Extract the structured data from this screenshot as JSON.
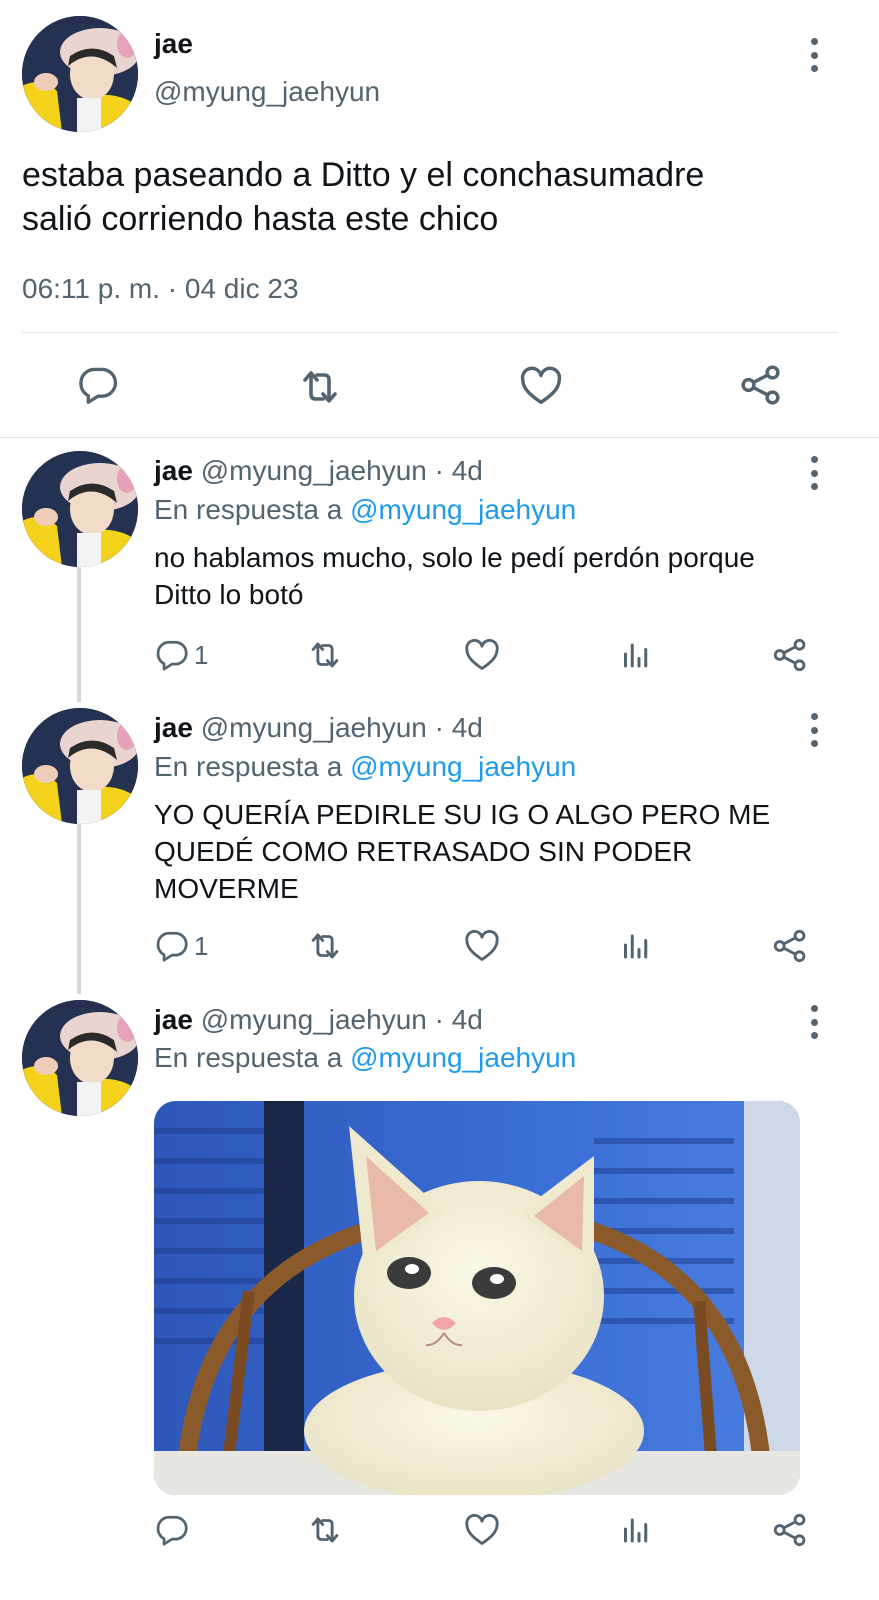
{
  "main_tweet": {
    "display_name": "jae",
    "handle": "@myung_jaehyun",
    "text_line1": "estaba paseando a Ditto y el conchasumadre",
    "text_line2": "salió corriendo hasta este chico",
    "timestamp": "06:11 p. m. · 04 dic 23"
  },
  "replies": [
    {
      "display_name": "jae",
      "handle_time": "@myung_jaehyun · 4d",
      "replying_prefix": "En respuesta a",
      "replying_handle": "@myung_jaehyun",
      "lines": [
        "no hablamos mucho, solo le pedí perdón porque",
        "Ditto lo botó"
      ],
      "reply_count": "1"
    },
    {
      "display_name": "jae",
      "handle_time": "@myung_jaehyun · 4d",
      "replying_prefix": "En respuesta a",
      "replying_handle": "@myung_jaehyun",
      "lines": [
        "YO QUERÍA PEDIRLE SU IG O ALGO PERO ME",
        "QUEDÉ COMO RETRASADO SIN PODER",
        "MOVERME"
      ],
      "reply_count": "1"
    },
    {
      "display_name": "jae",
      "handle_time": "@myung_jaehyun · 4d",
      "replying_prefix": "En respuesta a",
      "replying_handle": "@myung_jaehyun",
      "media": "crying-cat-photo"
    }
  ],
  "icons": {
    "reply": "speech-bubble-icon",
    "retweet": "retweet-icon",
    "like": "heart-icon",
    "analytics": "bar-chart-icon",
    "share": "share-icon",
    "more": "more-vertical-icon"
  },
  "colors": {
    "text": "#0f1419",
    "secondary": "#536471",
    "link": "#1d9bf0",
    "divider": "#e1e8ed"
  }
}
